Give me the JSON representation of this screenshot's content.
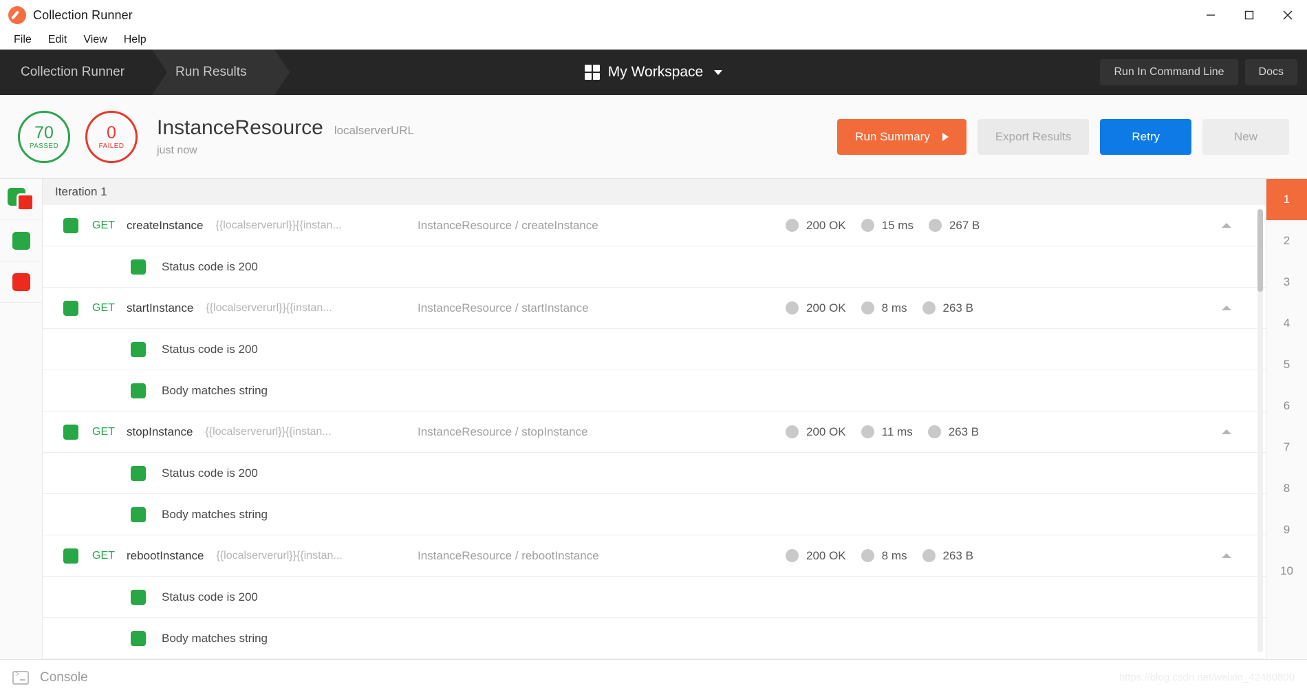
{
  "window": {
    "title": "Collection Runner",
    "logo_icon": "postman-logo-icon",
    "minimize_icon": "minimize-icon",
    "maximize_icon": "maximize-icon",
    "close_icon": "close-icon"
  },
  "menubar": {
    "items": [
      {
        "label": "File"
      },
      {
        "label": "Edit"
      },
      {
        "label": "View"
      },
      {
        "label": "Help"
      }
    ]
  },
  "navbar": {
    "breadcrumbs": [
      {
        "label": "Collection Runner",
        "active": false
      },
      {
        "label": "Run Results",
        "active": true
      }
    ],
    "workspace": {
      "grid_icon": "grid-icon",
      "name": "My Workspace",
      "caret_icon": "chevron-down-icon"
    },
    "actions": [
      {
        "label": "Run In Command Line"
      },
      {
        "label": "Docs"
      }
    ]
  },
  "summary": {
    "passed": {
      "count": "70",
      "label": "PASSED",
      "color": "#2da44e"
    },
    "failed": {
      "count": "0",
      "label": "FAILED",
      "color": "#e8382c"
    },
    "run_title": "InstanceResource",
    "environment": "localserverURL",
    "timestamp": "just now",
    "buttons": {
      "run_summary": "Run Summary",
      "export_results": "Export Results",
      "retry": "Retry",
      "new": "New"
    }
  },
  "filter_rail": {
    "items": [
      {
        "name": "filter-all",
        "icon": "all-results-icon"
      },
      {
        "name": "filter-passed",
        "icon": "passed-square-icon"
      },
      {
        "name": "filter-failed",
        "icon": "failed-square-icon"
      }
    ]
  },
  "results": {
    "iteration_header": "Iteration 1",
    "rows": [
      {
        "type": "request",
        "status_chip": "pass",
        "method": "GET",
        "name": "createInstance",
        "url": "{{localserverurl}}{{instan...",
        "path": "InstanceResource / createInstance",
        "status": "200 OK",
        "time": "15 ms",
        "size": "267 B",
        "collapse_icon": "chevron-up-icon"
      },
      {
        "type": "test",
        "status_chip": "pass",
        "label": "Status code is 200"
      },
      {
        "type": "request",
        "status_chip": "pass",
        "method": "GET",
        "name": "startInstance",
        "url": "{{localserverurl}}{{instan...",
        "path": "InstanceResource / startInstance",
        "status": "200 OK",
        "time": "8 ms",
        "size": "263 B",
        "collapse_icon": "chevron-up-icon"
      },
      {
        "type": "test",
        "status_chip": "pass",
        "label": "Status code is 200"
      },
      {
        "type": "test",
        "status_chip": "pass",
        "label": "Body matches string"
      },
      {
        "type": "request",
        "status_chip": "pass",
        "method": "GET",
        "name": "stopInstance",
        "url": "{{localserverurl}}{{instan...",
        "path": "InstanceResource / stopInstance",
        "status": "200 OK",
        "time": "11 ms",
        "size": "263 B",
        "collapse_icon": "chevron-up-icon"
      },
      {
        "type": "test",
        "status_chip": "pass",
        "label": "Status code is 200"
      },
      {
        "type": "test",
        "status_chip": "pass",
        "label": "Body matches string"
      },
      {
        "type": "request",
        "status_chip": "pass",
        "method": "GET",
        "name": "rebootInstance",
        "url": "{{localserverurl}}{{instan...",
        "path": "InstanceResource / rebootInstance",
        "status": "200 OK",
        "time": "8 ms",
        "size": "263 B",
        "collapse_icon": "chevron-up-icon"
      },
      {
        "type": "test",
        "status_chip": "pass",
        "label": "Status code is 200"
      },
      {
        "type": "test",
        "status_chip": "pass",
        "label": "Body matches string"
      }
    ]
  },
  "iterations": {
    "selected": "1",
    "items": [
      "1",
      "2",
      "3",
      "4",
      "5",
      "6",
      "7",
      "8",
      "9",
      "10"
    ]
  },
  "console": {
    "icon": "terminal-icon",
    "label": "Console",
    "watermark": "https://blog.csdn.net/weixin_42480800"
  }
}
